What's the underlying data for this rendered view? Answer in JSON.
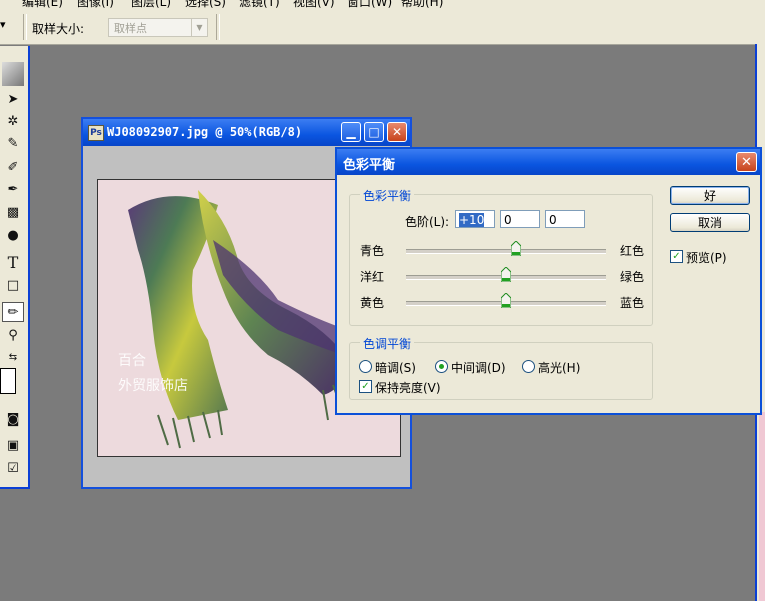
{
  "menubar": {
    "items": [
      "编辑(E)",
      "图像(I)",
      "图层(L)",
      "选择(S)",
      "滤镜(T)",
      "视图(V)",
      "窗口(W)",
      "帮助(H)"
    ]
  },
  "options_bar": {
    "sample_size_label": "取样大小:",
    "sample_size_value": "取样点"
  },
  "document": {
    "title": "WJ08092907.jpg @ 50%(RGB/8)",
    "watermark_line1": "百合",
    "watermark_line2": "外贸服饰店"
  },
  "dialog": {
    "title": "色彩平衡",
    "group_color_balance": "色彩平衡",
    "levels_label": "色阶(L):",
    "levels_values": [
      "+10",
      "0",
      "0"
    ],
    "sliders": [
      {
        "left": "青色",
        "right": "红色",
        "value": 10
      },
      {
        "left": "洋红",
        "right": "绿色",
        "value": 0
      },
      {
        "left": "黄色",
        "right": "蓝色",
        "value": 0
      }
    ],
    "group_tone_balance": "色调平衡",
    "tone_options": [
      "暗调(S)",
      "中间调(D)",
      "高光(H)"
    ],
    "tone_selected": "中间调(D)",
    "preserve_luminosity": "保持亮度(V)",
    "ok_label": "好",
    "cancel_label": "取消",
    "preview_label": "预览(P)"
  },
  "colors": {
    "titlebar": "#0a55e0",
    "dialog_bg": "#ece9d8",
    "workspace": "#7b7b7b"
  }
}
